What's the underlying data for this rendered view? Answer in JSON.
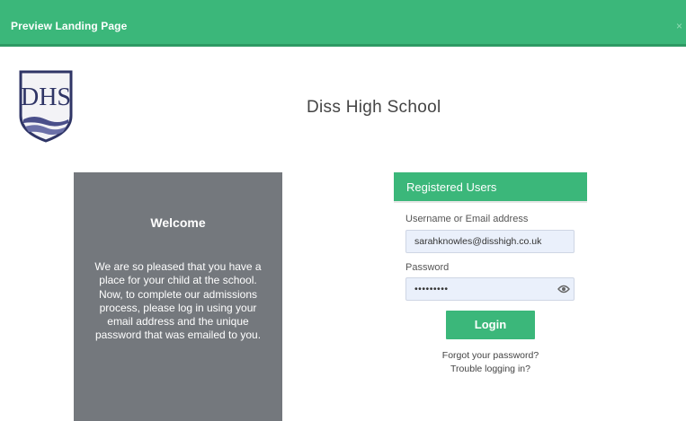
{
  "topbar": {
    "title": "Preview Landing Page",
    "close": "×"
  },
  "school": {
    "name": "Diss High School",
    "logo_text": "DHS"
  },
  "welcome": {
    "title": "Welcome",
    "text": "We are so pleased that you have a place for your child at the school.\nNow, to complete our admissions process, please log in using your email address and the unique password that was emailed to you."
  },
  "login": {
    "header": "Registered Users",
    "username_label": "Username or Email address",
    "username_value": "sarahknowles@disshigh.co.uk",
    "password_label": "Password",
    "password_value": "•••••••••",
    "button": "Login",
    "forgot": "Forgot your password?",
    "trouble": "Trouble logging in?"
  },
  "colors": {
    "accent": "#3bb77a",
    "panel": "#74787d",
    "field_bg": "#eaf0fb"
  }
}
